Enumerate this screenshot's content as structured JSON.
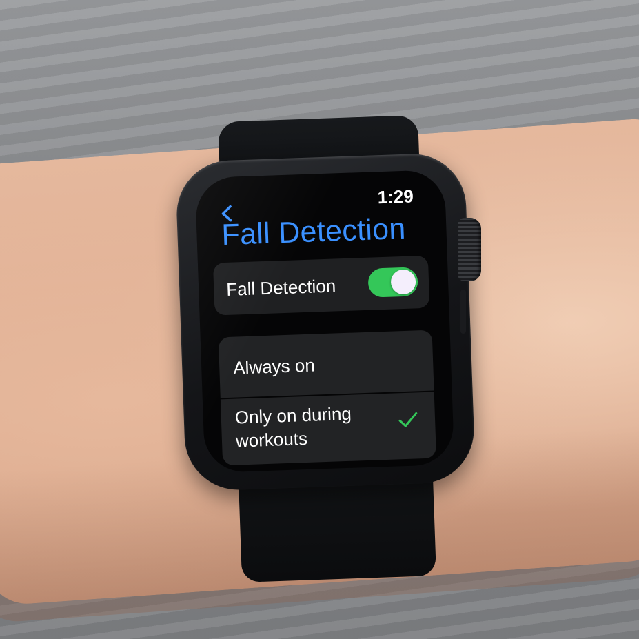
{
  "status_bar": {
    "time": "1:29"
  },
  "navigation": {
    "back_icon": "chevron-left-icon"
  },
  "page": {
    "title": "Fall Detection"
  },
  "toggle": {
    "label": "Fall Detection",
    "enabled": true
  },
  "options": [
    {
      "label": "Always on",
      "selected": false
    },
    {
      "label": "Only on during workouts",
      "selected": true
    }
  ],
  "colors": {
    "accent": "#3a90ff",
    "toggle_on": "#34c759",
    "checkmark": "#34c759",
    "screen_bg": "#050506",
    "cell_bg": "#222325"
  }
}
